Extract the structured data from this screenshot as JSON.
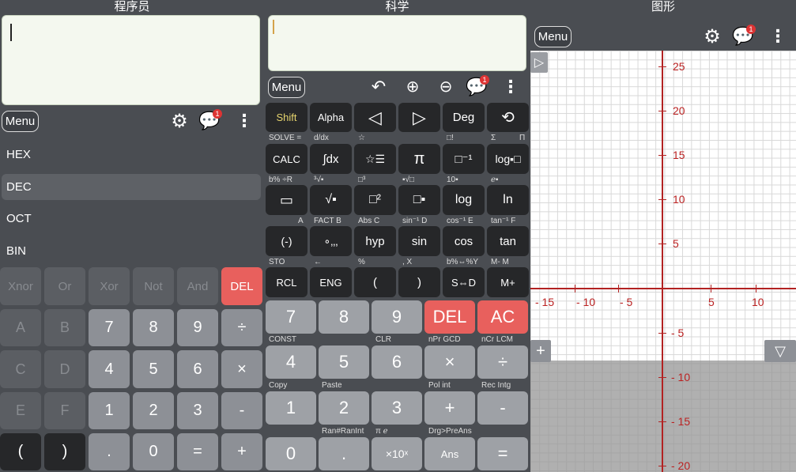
{
  "programmer": {
    "title": "程序员",
    "menu": "Menu",
    "badge": "1",
    "bases": [
      "HEX",
      "DEC",
      "OCT",
      "BIN"
    ],
    "row_logic": [
      "Xnor",
      "Or",
      "Xor",
      "Not",
      "And",
      "DEL"
    ],
    "rows": [
      [
        "A",
        "B",
        "7",
        "8",
        "9",
        "÷"
      ],
      [
        "C",
        "D",
        "4",
        "5",
        "6",
        "×"
      ],
      [
        "E",
        "F",
        "1",
        "2",
        "3",
        "-"
      ],
      [
        "(",
        ")",
        ".",
        "0",
        "=",
        "+"
      ]
    ]
  },
  "scientific": {
    "title": "科学",
    "menu": "Menu",
    "badge": "1",
    "row1": [
      "Shift",
      "Alpha",
      "◁",
      "▷",
      "Deg",
      "⟲"
    ],
    "hint1": [
      "SOLVE  =",
      "d/dx",
      "☆",
      "□!",
      "Σ",
      "Π"
    ],
    "row2": [
      "CALC",
      "∫dx",
      "☆☰",
      "π",
      "□⁻¹",
      "log▪□"
    ],
    "hint2": [
      "b%  ÷R",
      "³√▪",
      "□³",
      "▪√□",
      "10▪",
      "ℯ▪"
    ],
    "row3": [
      "▭",
      "√▪",
      "□²",
      "□▪",
      "log",
      "ln"
    ],
    "hint3": [
      "A",
      "FACT  B",
      "Abs  C",
      "sin⁻¹  D",
      "cos⁻¹  E",
      "tan⁻¹  F"
    ],
    "row4": [
      "(-)",
      "∘‚‚‚",
      "hyp",
      "sin",
      "cos",
      "tan"
    ],
    "hint4": [
      "STO",
      "←",
      "%",
      ",  X",
      "b%⇔%Y",
      "M-  M"
    ],
    "row5": [
      "RCL",
      "ENG",
      "(",
      ")",
      "S⇔D",
      "M+"
    ],
    "row6": [
      "7",
      "8",
      "9",
      "DEL",
      "AC"
    ],
    "hint6": [
      "CONST",
      "CLR",
      "nPr  GCD",
      "nCr  LCM"
    ],
    "row7": [
      "4",
      "5",
      "6",
      "×",
      "÷"
    ],
    "hint7": [
      "Copy",
      "Paste",
      "Pol  int",
      "Rec  Intg"
    ],
    "row8": [
      "1",
      "2",
      "3",
      "+",
      "-"
    ],
    "hint8": [
      "Ran#RanInt",
      "π      ℯ",
      "Drg>PreAns"
    ],
    "row9": [
      "0",
      ".",
      "×10ˣ",
      "Ans",
      "="
    ]
  },
  "graph": {
    "title": "图形",
    "menu": "Menu",
    "badge": "1",
    "x_ticks": [
      "- 15",
      "- 10",
      "- 5",
      "5",
      "10"
    ],
    "y_ticks": [
      "25",
      "20",
      "15",
      "10",
      "5",
      "- 5",
      "- 10",
      "- 15",
      "- 20"
    ],
    "axis_color": "#b22222"
  }
}
